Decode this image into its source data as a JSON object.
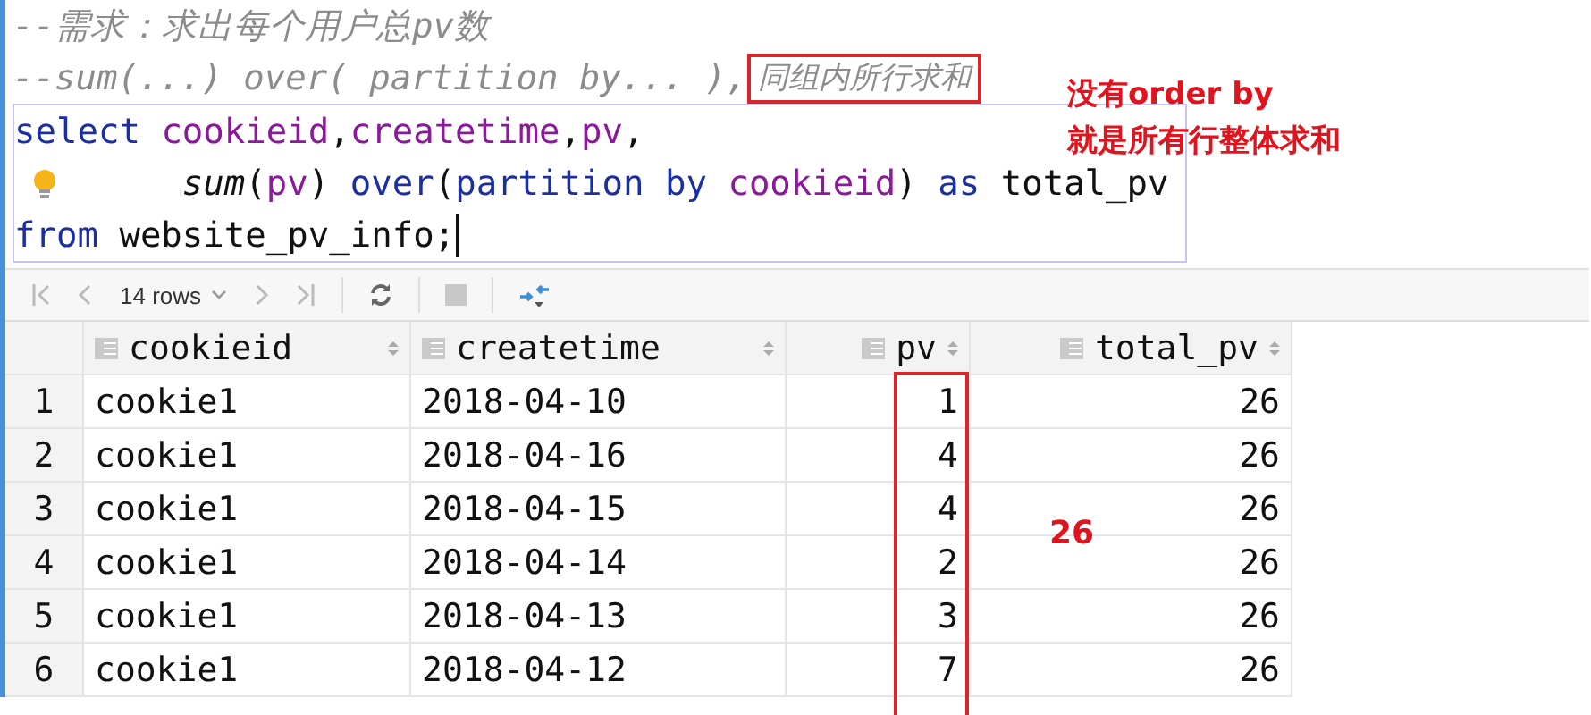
{
  "editor": {
    "lines": [
      {
        "tokens": [
          {
            "text": "--需求：求出每个用户总pv数",
            "kind": "comment"
          }
        ]
      },
      {
        "tokens": [
          {
            "text": "--sum(...) over( partition by... ),",
            "kind": "comment"
          },
          {
            "text": "同组内所行求和",
            "kind": "boxed_comment"
          }
        ]
      },
      {
        "in_statement": true,
        "tokens": [
          {
            "text": "select ",
            "kind": "keyword"
          },
          {
            "text": "cookieid",
            "kind": "ident"
          },
          {
            "text": ",",
            "kind": "plain"
          },
          {
            "text": "createtime",
            "kind": "ident"
          },
          {
            "text": ",",
            "kind": "plain"
          },
          {
            "text": "pv",
            "kind": "ident"
          },
          {
            "text": ",",
            "kind": "plain"
          }
        ]
      },
      {
        "in_statement": true,
        "indent": true,
        "hint": true,
        "tokens": [
          {
            "text": "sum",
            "kind": "function"
          },
          {
            "text": "(",
            "kind": "plain"
          },
          {
            "text": "pv",
            "kind": "ident"
          },
          {
            "text": ") ",
            "kind": "plain"
          },
          {
            "text": "over",
            "kind": "keyword"
          },
          {
            "text": "(",
            "kind": "plain"
          },
          {
            "text": "partition by ",
            "kind": "keyword"
          },
          {
            "text": "cookieid",
            "kind": "ident"
          },
          {
            "text": ") ",
            "kind": "plain"
          },
          {
            "text": "as ",
            "kind": "keyword"
          },
          {
            "text": "total_pv",
            "kind": "plain"
          }
        ]
      },
      {
        "in_statement": true,
        "cursor": true,
        "tokens": [
          {
            "text": "from ",
            "kind": "keyword"
          },
          {
            "text": "website_pv_info;",
            "kind": "plain"
          }
        ]
      }
    ]
  },
  "toolbar": {
    "rows_label": "14 rows"
  },
  "table": {
    "columns": [
      {
        "name": "cookieid"
      },
      {
        "name": "createtime"
      },
      {
        "name": "pv"
      },
      {
        "name": "total_pv"
      }
    ],
    "rows": [
      {
        "number": "1",
        "cells": [
          "cookie1",
          "2018-04-10",
          "1",
          "26"
        ]
      },
      {
        "number": "2",
        "cells": [
          "cookie1",
          "2018-04-16",
          "4",
          "26"
        ]
      },
      {
        "number": "3",
        "cells": [
          "cookie1",
          "2018-04-15",
          "4",
          "26"
        ]
      },
      {
        "number": "4",
        "cells": [
          "cookie1",
          "2018-04-14",
          "2",
          "26"
        ]
      },
      {
        "number": "5",
        "cells": [
          "cookie1",
          "2018-04-13",
          "3",
          "26"
        ]
      },
      {
        "number": "6",
        "cells": [
          "cookie1",
          "2018-04-12",
          "7",
          "26"
        ]
      }
    ]
  },
  "annotations": {
    "note_lines": [
      "没有order by",
      "就是所有行整体求和"
    ],
    "sum_label": "26"
  }
}
